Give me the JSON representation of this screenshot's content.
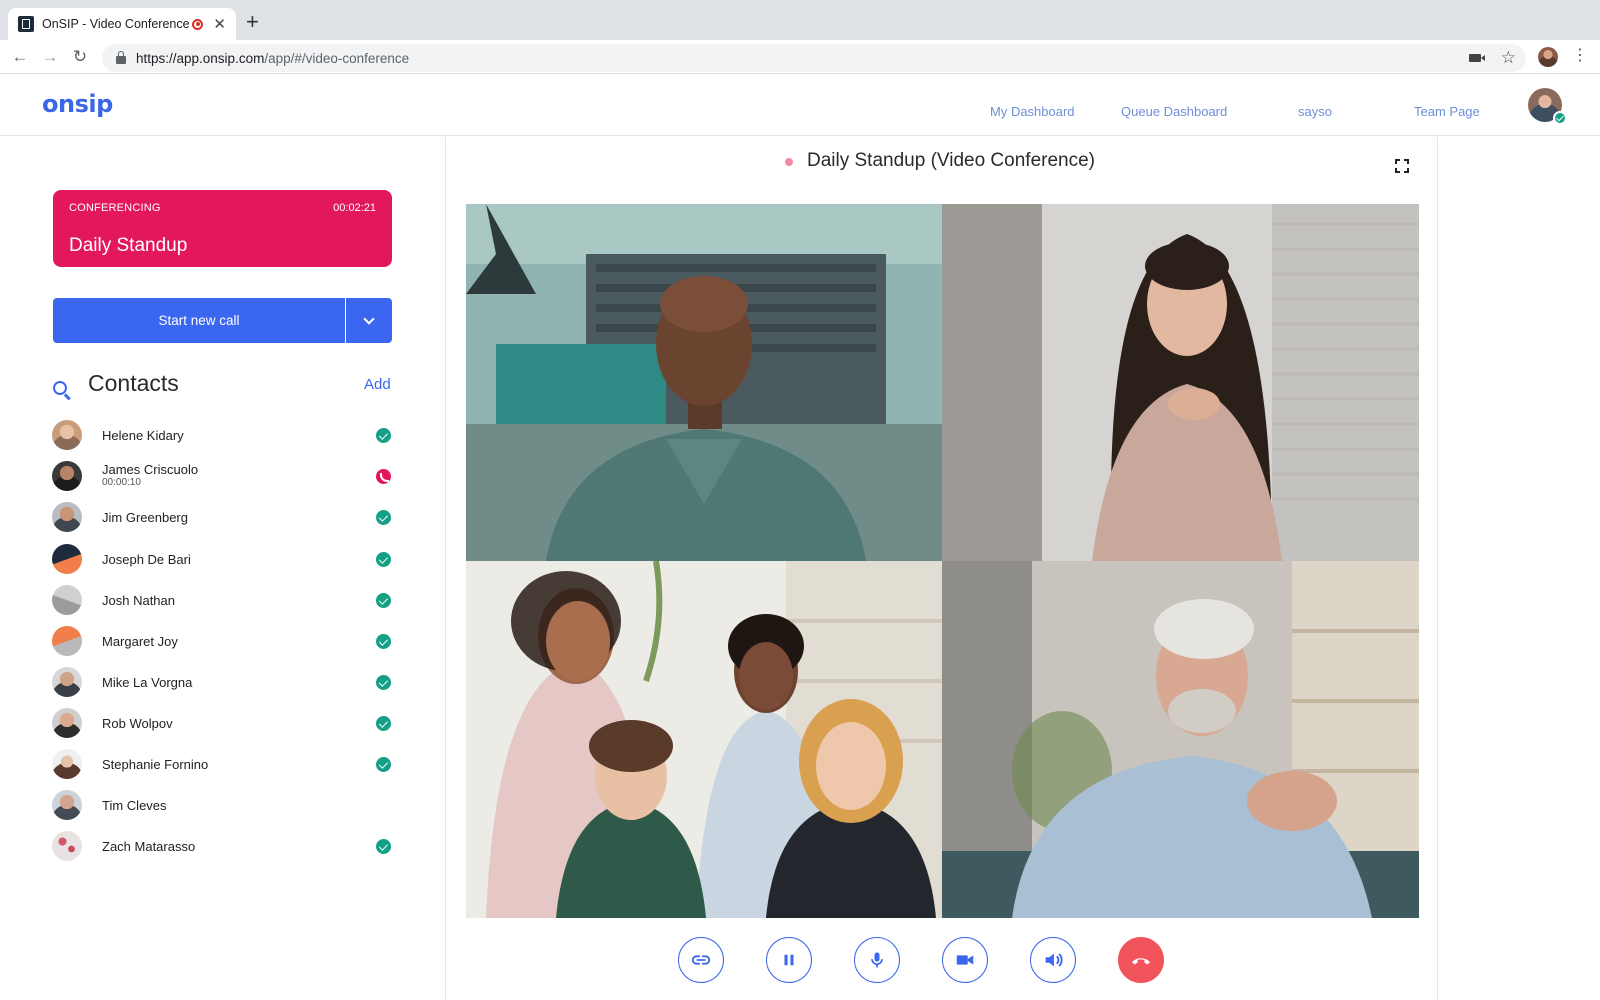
{
  "browser": {
    "tab_title": "OnSIP - Video Conference",
    "url_host": "https://app.onsip.com",
    "url_path": "/app/#/video-conference"
  },
  "header": {
    "logo": "onsip",
    "nav": [
      "My Dashboard",
      "Queue Dashboard",
      "sayso",
      "Team Page"
    ]
  },
  "conference_card": {
    "status": "CONFERENCING",
    "timer": "00:02:21",
    "name": "Daily Standup"
  },
  "start_call": {
    "label": "Start new call"
  },
  "contacts": {
    "title": "Contacts",
    "add_label": "Add",
    "items": [
      {
        "name": "Helene Kidary",
        "status": "available"
      },
      {
        "name": "James Criscuolo",
        "sub": "00:00:10",
        "status": "on-call"
      },
      {
        "name": "Jim Greenberg",
        "status": "available"
      },
      {
        "name": "Joseph De Bari",
        "status": "available"
      },
      {
        "name": "Josh Nathan",
        "status": "available"
      },
      {
        "name": "Margaret Joy",
        "status": "available"
      },
      {
        "name": "Mike La Vorgna",
        "status": "available"
      },
      {
        "name": "Rob Wolpov",
        "status": "available"
      },
      {
        "name": "Stephanie Fornino",
        "status": "available"
      },
      {
        "name": "Tim Cleves",
        "status": "none"
      },
      {
        "name": "Zach Matarasso",
        "status": "available"
      }
    ]
  },
  "conference": {
    "title": "Daily Standup (Video Conference)"
  },
  "controls": [
    "link-icon",
    "pause-icon",
    "microphone-icon",
    "video-camera-icon",
    "speaker-icon",
    "hang-up-icon"
  ],
  "colors": {
    "accent": "#3a66f0",
    "conferencing": "#e3185c",
    "available": "#13a085",
    "hangup": "#f2545b"
  }
}
